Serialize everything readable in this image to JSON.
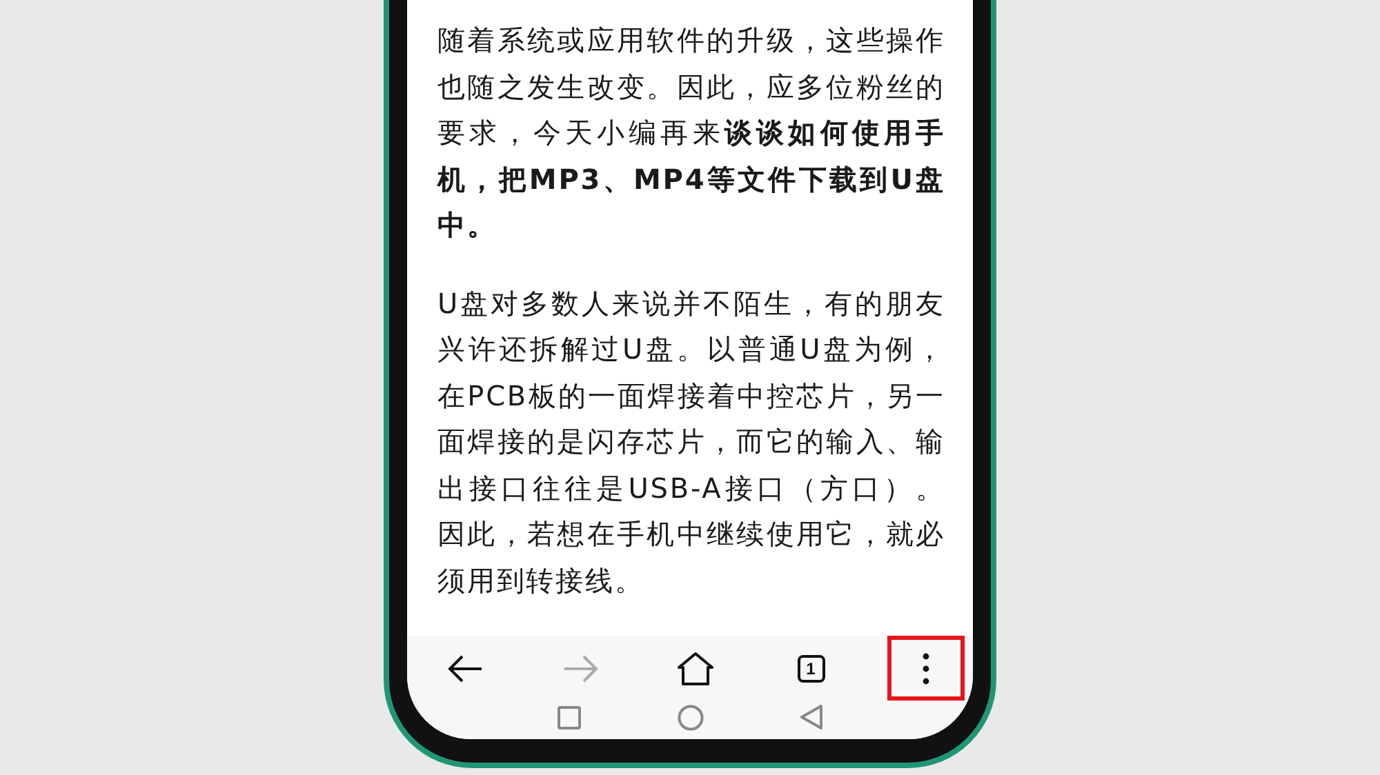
{
  "article": {
    "paragraphs": [
      "随着系统或应用软件的升级，这些操作也随之发生改变。因此，应多位粉丝的要求，今天小编再来**谈谈如何使用手机，把MP3、MP4等文件下载到U盘中。**",
      "U盘对多数人来说并不陌生，有的朋友兴许还拆解过U盘。以普通U盘为例，在PCB板的一面焊接着中控芯片，另一面焊接的是闪存芯片，而它的输入、输出接口往往是USB-A接口（方口）。因此，若想在手机中继续使用它，就必须用到转接线。"
    ]
  },
  "toolbar": {
    "buttons": [
      {
        "kind": "back",
        "disabled": false,
        "highlighted": false
      },
      {
        "kind": "forward",
        "disabled": true,
        "highlighted": false
      },
      {
        "kind": "home",
        "disabled": false,
        "highlighted": false
      },
      {
        "kind": "tabs",
        "count": "1",
        "disabled": false,
        "highlighted": false
      },
      {
        "kind": "menu",
        "disabled": false,
        "highlighted": true
      }
    ]
  },
  "nav_bar": {
    "buttons": [
      {
        "kind": "recents"
      },
      {
        "kind": "home"
      },
      {
        "kind": "back"
      }
    ]
  }
}
